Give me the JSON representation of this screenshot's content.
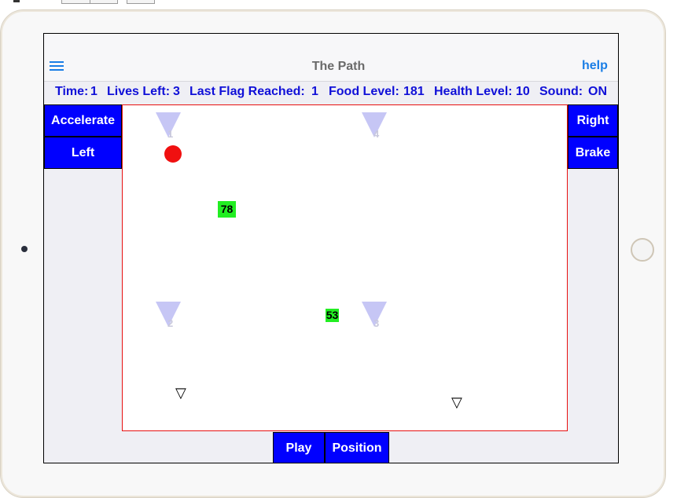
{
  "app": {
    "title": "The Path",
    "help_label": "help",
    "menu_icon": "hamburger-menu-icon"
  },
  "status": {
    "time_label": "Time:",
    "time_value": "1",
    "lives_label": "Lives Left:",
    "lives_value": "3",
    "flag_label": "Last Flag Reached:",
    "flag_value": "1",
    "food_label": "Food Level:",
    "food_value": "181",
    "health_label": "Health Level:",
    "health_value": "10",
    "sound_label": "Sound:",
    "sound_value": "ON"
  },
  "controls": {
    "accelerate": "Accelerate",
    "left": "Left",
    "right": "Right",
    "brake": "Brake",
    "play": "Play",
    "position": "Position"
  },
  "game": {
    "flags": [
      {
        "number": "1"
      },
      {
        "number": "4"
      },
      {
        "number": "2"
      },
      {
        "number": "3"
      }
    ],
    "food_items": [
      {
        "value": "78"
      },
      {
        "value": "53"
      }
    ],
    "hazard_glyph": "▽",
    "colors": {
      "button_bg": "#0000ff",
      "player": "#f01010",
      "food": "#22ee22",
      "flag": "#c6c6f5",
      "border": "#e81010",
      "status_text": "#1010d8",
      "link": "#1a7ee6"
    }
  }
}
